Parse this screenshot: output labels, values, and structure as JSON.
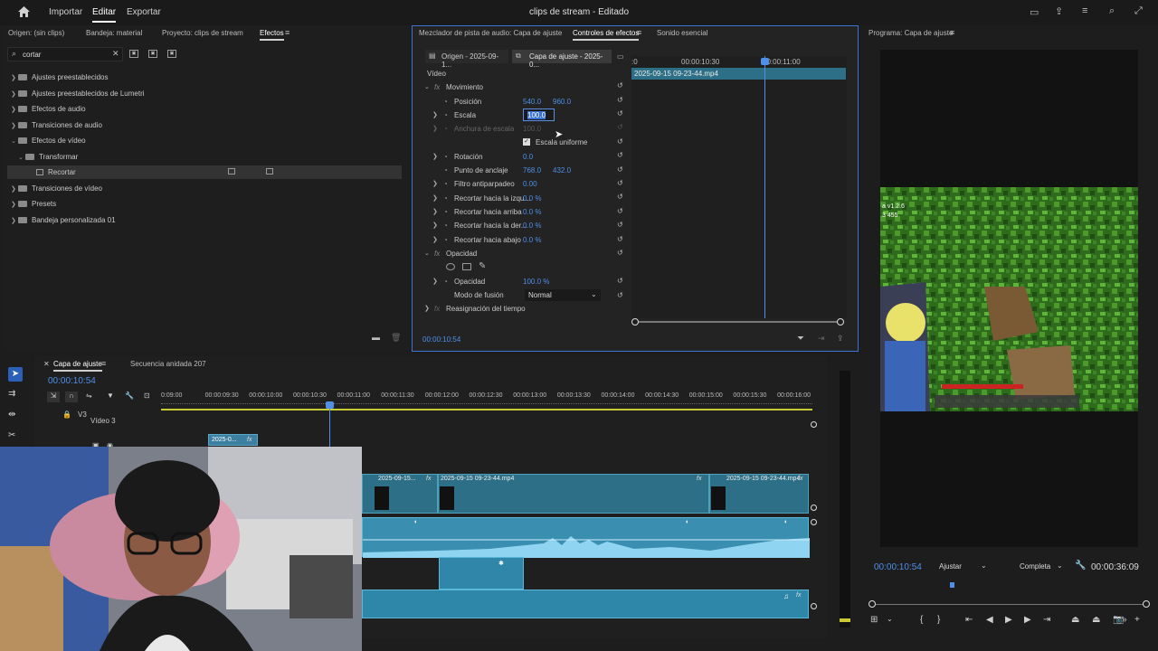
{
  "header": {
    "menu": [
      "Importar",
      "Editar",
      "Exportar"
    ],
    "active_menu": "Editar",
    "title": "clips de stream - Editado"
  },
  "project_panel": {
    "tabs": [
      "Origen: (sin clips)",
      "Bandeja: material",
      "Proyecto: clips de stream",
      "Efectos"
    ],
    "active_tab": "Efectos",
    "search_value": "cortar",
    "tree": [
      "Ajustes preestablecidos",
      "Ajustes preestablecidos de Lumetri",
      "Efectos de audio",
      "Transiciones de audio",
      "Efectos de vídeo",
      "Transformar",
      "Recortar",
      "Transiciones de vídeo",
      "Presets",
      "Bandeja personalizada 01"
    ]
  },
  "effect_controls": {
    "tabs": [
      "Mezclador de pista de audio: Capa de ajuste",
      "Controles de efectos",
      "Sonido esencial"
    ],
    "active_tab": "Controles de efectos",
    "source_tabs": [
      "Origen - 2025-09-1...",
      "Capa de ajuste - 2025-0..."
    ],
    "section": "Vídeo",
    "movement": "Movimiento",
    "params": [
      {
        "label": "Posición",
        "v1": "540.0",
        "v2": "960.0"
      },
      {
        "label": "Escala",
        "v1": "100.0",
        "v2": ""
      },
      {
        "label": "Anchura de escala",
        "v1": "100.0",
        "v2": ""
      },
      {
        "label": "Rotación",
        "v1": "0.0",
        "v2": ""
      },
      {
        "label": "Punto de anclaje",
        "v1": "768.0",
        "v2": "432.0"
      },
      {
        "label": "Filtro antiparpadeo",
        "v1": "0.00",
        "v2": ""
      },
      {
        "label": "Recortar hacia la izqu...",
        "v1": "0.0 %",
        "v2": ""
      },
      {
        "label": "Recortar hacia arriba",
        "v1": "0.0 %",
        "v2": ""
      },
      {
        "label": "Recortar hacia la der...",
        "v1": "0.0 %",
        "v2": ""
      },
      {
        "label": "Recortar hacia abajo",
        "v1": "0.0 %",
        "v2": ""
      }
    ],
    "uniform_scale": "Escala uniforme",
    "opacity_section": "Opacidad",
    "opacity_label": "Opacidad",
    "opacity_value": "100.0 %",
    "blend_label": "Modo de fusión",
    "blend_value": "Normal",
    "time_remap": "Reasignación del tiempo",
    "ruler": [
      "00:00:10:30",
      "00:00:11:00"
    ],
    "clip_name": "2025-09-15 09-23-44.mp4",
    "timecode": "00:00:10:54"
  },
  "program": {
    "title": "Programa: Capa de ajuste",
    "timecode": "00:00:10:54",
    "fit": "Ajustar",
    "quality": "Completa",
    "duration": "00:00:36:09",
    "overlay_text": [
      "a v1.2.6",
      "3 455"
    ]
  },
  "timeline": {
    "tabs": [
      "Capa de ajuste",
      "Secuencia anidada 207"
    ],
    "timecode": "00:00:10:54",
    "ruler": [
      "0:09:00",
      "00:00:09:30",
      "00:00:10:00",
      "00:00:10:30",
      "00:00:11:00",
      "00:00:11:30",
      "00:00:12:00",
      "00:00:12:30",
      "00:00:13:00",
      "00:00:13:30",
      "00:00:14:00",
      "00:00:14:30",
      "00:00:15:00",
      "00:00:15:30",
      "00:00:16:00"
    ],
    "track_v3": "V3",
    "track_v3_name": "Vídeo 3",
    "adjust_clip": "2025-0...",
    "clips": [
      "2025-09-15...",
      "2025-09-15 09-23-44.mp4",
      "2025-09-15 09-23-44.mp4"
    ]
  },
  "colors": {
    "accent": "#4f8fe8",
    "clip": "#2d6f86",
    "audio": "#3a8fb0"
  }
}
